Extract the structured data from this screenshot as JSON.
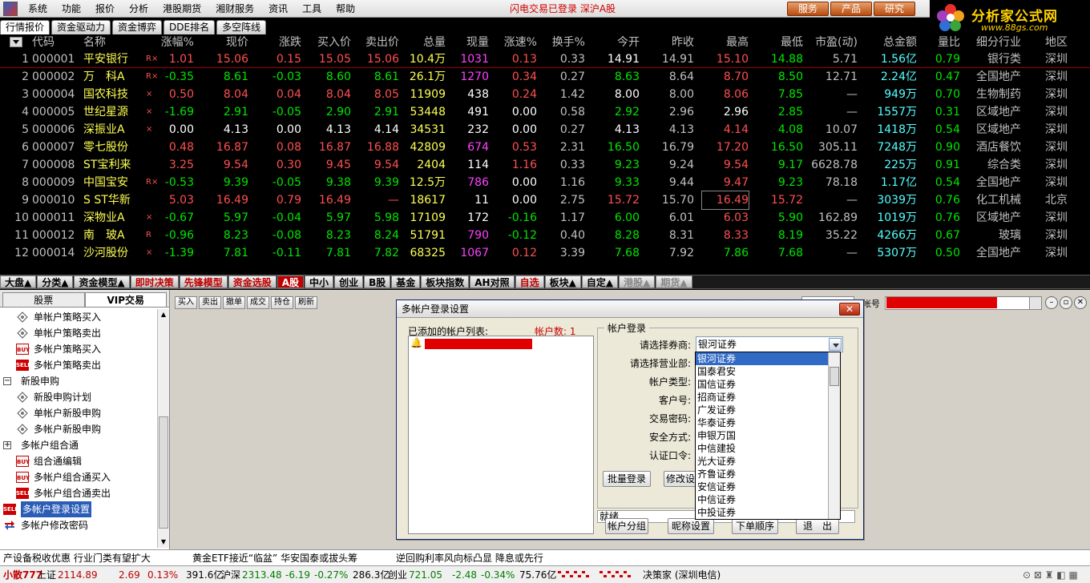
{
  "menu": {
    "items": [
      "系统",
      "功能",
      "报价",
      "分析",
      "港股期货",
      "湘财服务",
      "资讯",
      "工具",
      "帮助"
    ],
    "status": "闪电交易已登录   深沪A股",
    "top_buttons": [
      "服务",
      "产品",
      "研究"
    ]
  },
  "brand": {
    "name": "分析家公式网",
    "url": "www.88gs.com"
  },
  "tabs": [
    "行情报价",
    "资金驱动力",
    "资金博弈",
    "DDE排名",
    "多空阵线"
  ],
  "quote": {
    "headers": [
      "代码",
      "名称",
      "涨幅%",
      "现价",
      "涨跌",
      "买入价",
      "卖出价",
      "总量",
      "现量",
      "涨速%",
      "换手%",
      "今开",
      "昨收",
      "最高",
      "最低",
      "市盈(动)",
      "总金额",
      "量比",
      "细分行业",
      "地区"
    ],
    "rows": [
      {
        "idx": "1",
        "code": "000001",
        "name": "平安银行",
        "flag": "R×",
        "pct": "1.01",
        "price": "15.06",
        "chg": "0.15",
        "bid": "15.05",
        "ask": "15.06",
        "vol": "10.4万",
        "cur": "1031",
        "spd": "0.13",
        "turn": "0.33",
        "open": "14.91",
        "prev": "14.91",
        "high": "15.10",
        "low": "14.88",
        "pe": "5.71",
        "amt": "1.56亿",
        "ratio": "0.79",
        "ind": "银行类",
        "reg": "深圳",
        "dir": "up",
        "open_dir": "white",
        "high_dir": "up",
        "low_dir": "down",
        "cur_color": "magenta"
      },
      {
        "idx": "2",
        "code": "000002",
        "name": "万　科A",
        "flag": "R×",
        "pct": "-0.35",
        "price": "8.61",
        "chg": "-0.03",
        "bid": "8.60",
        "ask": "8.61",
        "vol": "26.1万",
        "cur": "1270",
        "spd": "0.34",
        "turn": "0.27",
        "open": "8.63",
        "prev": "8.64",
        "high": "8.70",
        "low": "8.50",
        "pe": "12.71",
        "amt": "2.24亿",
        "ratio": "0.47",
        "ind": "全国地产",
        "reg": "深圳",
        "dir": "down",
        "open_dir": "down",
        "high_dir": "up",
        "low_dir": "down",
        "cur_color": "magenta"
      },
      {
        "idx": "3",
        "code": "000004",
        "name": "国农科技",
        "flag": "×",
        "pct": "0.50",
        "price": "8.04",
        "chg": "0.04",
        "bid": "8.04",
        "ask": "8.05",
        "vol": "11909",
        "cur": "438",
        "spd": "0.24",
        "turn": "1.42",
        "open": "8.00",
        "prev": "8.00",
        "high": "8.06",
        "low": "7.85",
        "pe": "—",
        "amt": "949万",
        "ratio": "0.70",
        "ind": "生物制药",
        "reg": "深圳",
        "dir": "up",
        "open_dir": "white",
        "high_dir": "up",
        "low_dir": "down",
        "cur_color": "white"
      },
      {
        "idx": "4",
        "code": "000005",
        "name": "世纪星源",
        "flag": "×",
        "pct": "-1.69",
        "price": "2.91",
        "chg": "-0.05",
        "bid": "2.90",
        "ask": "2.91",
        "vol": "53448",
        "cur": "491",
        "spd": "0.00",
        "turn": "0.58",
        "open": "2.92",
        "prev": "2.96",
        "high": "2.96",
        "low": "2.85",
        "pe": "—",
        "amt": "1557万",
        "ratio": "0.31",
        "ind": "区域地产",
        "reg": "深圳",
        "dir": "down",
        "open_dir": "down",
        "high_dir": "white",
        "low_dir": "down",
        "cur_color": "white"
      },
      {
        "idx": "5",
        "code": "000006",
        "name": "深振业A",
        "flag": "×",
        "pct": "0.00",
        "price": "4.13",
        "chg": "0.00",
        "bid": "4.13",
        "ask": "4.14",
        "vol": "34531",
        "cur": "232",
        "spd": "0.00",
        "turn": "0.27",
        "open": "4.13",
        "prev": "4.13",
        "high": "4.14",
        "low": "4.08",
        "pe": "10.07",
        "amt": "1418万",
        "ratio": "0.54",
        "ind": "区域地产",
        "reg": "深圳",
        "dir": "flat",
        "open_dir": "white",
        "high_dir": "up",
        "low_dir": "down",
        "cur_color": "white"
      },
      {
        "idx": "6",
        "code": "000007",
        "name": "零七股份",
        "flag": "",
        "pct": "0.48",
        "price": "16.87",
        "chg": "0.08",
        "bid": "16.87",
        "ask": "16.88",
        "vol": "42809",
        "cur": "674",
        "spd": "0.53",
        "turn": "2.31",
        "open": "16.50",
        "prev": "16.79",
        "high": "17.20",
        "low": "16.50",
        "pe": "305.11",
        "amt": "7248万",
        "ratio": "0.90",
        "ind": "酒店餐饮",
        "reg": "深圳",
        "dir": "up",
        "open_dir": "down",
        "high_dir": "up",
        "low_dir": "down",
        "cur_color": "magenta"
      },
      {
        "idx": "7",
        "code": "000008",
        "name": "ST宝利来",
        "flag": "",
        "pct": "3.25",
        "price": "9.54",
        "chg": "0.30",
        "bid": "9.45",
        "ask": "9.54",
        "vol": "2404",
        "cur": "114",
        "spd": "1.16",
        "turn": "0.33",
        "open": "9.23",
        "prev": "9.24",
        "high": "9.54",
        "low": "9.17",
        "pe": "6628.78",
        "amt": "225万",
        "ratio": "0.91",
        "ind": "综合类",
        "reg": "深圳",
        "dir": "up",
        "open_dir": "down",
        "high_dir": "up",
        "low_dir": "down",
        "cur_color": "white"
      },
      {
        "idx": "8",
        "code": "000009",
        "name": "中国宝安",
        "flag": "R×",
        "pct": "-0.53",
        "price": "9.39",
        "chg": "-0.05",
        "bid": "9.38",
        "ask": "9.39",
        "vol": "12.5万",
        "cur": "786",
        "spd": "0.00",
        "turn": "1.16",
        "open": "9.33",
        "prev": "9.44",
        "high": "9.47",
        "low": "9.23",
        "pe": "78.18",
        "amt": "1.17亿",
        "ratio": "0.54",
        "ind": "全国地产",
        "reg": "深圳",
        "dir": "down",
        "open_dir": "down",
        "high_dir": "up",
        "low_dir": "down",
        "cur_color": "magenta"
      },
      {
        "idx": "9",
        "code": "000010",
        "name": "S ST华新",
        "flag": "",
        "pct": "5.03",
        "price": "16.49",
        "chg": "0.79",
        "bid": "16.49",
        "ask": "—",
        "vol": "18617",
        "cur": "11",
        "spd": "0.00",
        "turn": "2.75",
        "open": "15.72",
        "prev": "15.70",
        "high": "16.49",
        "low": "15.72",
        "pe": "—",
        "amt": "3039万",
        "ratio": "0.76",
        "ind": "化工机械",
        "reg": "北京",
        "dir": "up",
        "open_dir": "up",
        "high_dir": "up",
        "low_dir": "up",
        "cur_color": "white"
      },
      {
        "idx": "10",
        "code": "000011",
        "name": "深物业A",
        "flag": "×",
        "pct": "-0.67",
        "price": "5.97",
        "chg": "-0.04",
        "bid": "5.97",
        "ask": "5.98",
        "vol": "17109",
        "cur": "172",
        "spd": "-0.16",
        "turn": "1.17",
        "open": "6.00",
        "prev": "6.01",
        "high": "6.03",
        "low": "5.90",
        "pe": "162.89",
        "amt": "1019万",
        "ratio": "0.76",
        "ind": "区域地产",
        "reg": "深圳",
        "dir": "down",
        "open_dir": "down",
        "high_dir": "up",
        "low_dir": "down",
        "cur_color": "white"
      },
      {
        "idx": "11",
        "code": "000012",
        "name": "南　玻A",
        "flag": "R",
        "pct": "-0.96",
        "price": "8.23",
        "chg": "-0.08",
        "bid": "8.23",
        "ask": "8.24",
        "vol": "51791",
        "cur": "790",
        "spd": "-0.12",
        "turn": "0.40",
        "open": "8.28",
        "prev": "8.31",
        "high": "8.33",
        "low": "8.19",
        "pe": "35.22",
        "amt": "4266万",
        "ratio": "0.67",
        "ind": "玻璃",
        "reg": "深圳",
        "dir": "down",
        "open_dir": "down",
        "high_dir": "up",
        "low_dir": "down",
        "cur_color": "magenta"
      },
      {
        "idx": "12",
        "code": "000014",
        "name": "沙河股份",
        "flag": "×",
        "pct": "-1.39",
        "price": "7.81",
        "chg": "-0.11",
        "bid": "7.81",
        "ask": "7.82",
        "vol": "68325",
        "cur": "1067",
        "spd": "0.12",
        "turn": "3.39",
        "open": "7.68",
        "prev": "7.92",
        "high": "7.86",
        "low": "7.68",
        "pe": "—",
        "amt": "5307万",
        "ratio": "0.50",
        "ind": "全国地产",
        "reg": "深圳",
        "dir": "down",
        "open_dir": "down",
        "high_dir": "down",
        "low_dir": "down",
        "cur_color": "magenta"
      }
    ]
  },
  "categories": [
    {
      "label": "大盘▲",
      "style": ""
    },
    {
      "label": "分类▲",
      "style": ""
    },
    {
      "label": "资金模型▲",
      "style": ""
    },
    {
      "label": "即时决策",
      "style": "red"
    },
    {
      "label": "先锋模型",
      "style": "red"
    },
    {
      "label": "资金选股",
      "style": "red"
    },
    {
      "label": "A股",
      "style": "sel"
    },
    {
      "label": "中小",
      "style": ""
    },
    {
      "label": "创业",
      "style": ""
    },
    {
      "label": "B股",
      "style": ""
    },
    {
      "label": "基金",
      "style": ""
    },
    {
      "label": "板块指数",
      "style": ""
    },
    {
      "label": "AH对照",
      "style": ""
    },
    {
      "label": "自选",
      "style": "red"
    },
    {
      "label": "板块▲",
      "style": ""
    },
    {
      "label": "自定▲",
      "style": ""
    },
    {
      "label": "港股▲",
      "style": "dim"
    },
    {
      "label": "期货▲",
      "style": "dim"
    }
  ],
  "sidebar": {
    "tabs": [
      "股票",
      "VIP交易"
    ],
    "items": [
      {
        "label": "单帐户策略买入",
        "icon": "diamond",
        "indent": 1
      },
      {
        "label": "单帐户策略卖出",
        "icon": "diamond",
        "indent": 1
      },
      {
        "label": "多帐户策略买入",
        "icon": "buy",
        "indent": 1
      },
      {
        "label": "多帐户策略卖出",
        "icon": "sell",
        "indent": 1
      },
      {
        "label": "新股申购",
        "icon": "minus",
        "indent": 0
      },
      {
        "label": "新股申购计划",
        "icon": "diamond",
        "indent": 1
      },
      {
        "label": "单帐户新股申购",
        "icon": "diamond",
        "indent": 1
      },
      {
        "label": "多帐户新股申购",
        "icon": "diamond",
        "indent": 1
      },
      {
        "label": "多帐户组合通",
        "icon": "plus",
        "indent": 0
      },
      {
        "label": "组合通编辑",
        "icon": "buy",
        "indent": 1
      },
      {
        "label": "多帐户组合通买入",
        "icon": "buy",
        "indent": 1
      },
      {
        "label": "多帐户组合通卖出",
        "icon": "sell",
        "indent": 1
      },
      {
        "label": "多帐户登录设置",
        "icon": "sell",
        "indent": 0,
        "selected": true
      },
      {
        "label": "多帐户修改密码",
        "icon": "arrows",
        "indent": 0
      }
    ]
  },
  "toolbar": {
    "buttons": [
      "买入",
      "卖出",
      "撤单",
      "成交",
      "持仓",
      "刷新"
    ],
    "account_label": "帐号"
  },
  "dialog": {
    "title": "多帐户登录设置",
    "close": "✕",
    "added_label": "已添加的帐户列表:",
    "count_label": "帐户数: 1",
    "group_title": "帐户登录",
    "fields": [
      "请选择券商:",
      "请选择营业部:",
      "帐户类型:",
      "客户号:",
      "交易密码:",
      "安全方式:",
      "认证口令:"
    ],
    "broker_selected": "银河证券",
    "broker_options": [
      "银河证券",
      "国泰君安",
      "国信证券",
      "招商证券",
      "广发证券",
      "华泰证券",
      "申银万国",
      "中信建投",
      "光大证券",
      "齐鲁证券",
      "安信证券",
      "中信证券",
      "中投证券"
    ],
    "batch_login": "批量登录",
    "modify": "修改设",
    "status": "就绪.",
    "footer_buttons": [
      "帐户分组",
      "昵称设置",
      "下单顺序",
      "退　出"
    ]
  },
  "ticker": {
    "items": [
      "产设备税收优惠  行业门类有望扩大",
      "黄金ETF接近“临盆”  华安国泰或拔头筹",
      "逆回购利率风向标凸显  降息或先行"
    ]
  },
  "statusbar": {
    "label": "小散777",
    "sh_name": "上证",
    "sh_index": "2114.89",
    "sh_chg": "2.69",
    "sh_pct": "0.13%",
    "sh_amt": "391.6亿",
    "sz_name": "沪深",
    "sz_index": "2313.48",
    "sz_chg": "-6.19",
    "sz_pct": "-0.27%",
    "sz_amt": "286.3亿",
    "cy_name": "创业",
    "cy_index": "721.05",
    "cy_chg": "-2.48",
    "cy_pct": "-0.34%",
    "cy_amt": "75.76亿",
    "server": "决策家 (深圳电信)"
  }
}
